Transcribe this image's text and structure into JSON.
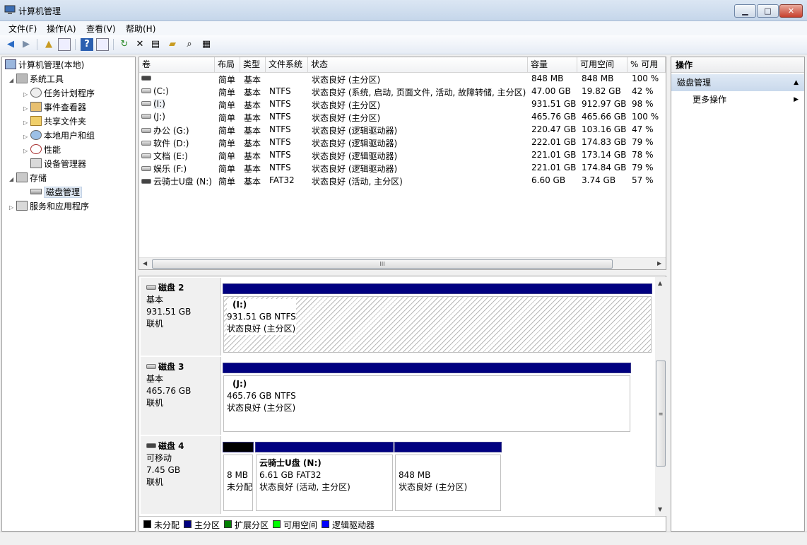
{
  "window": {
    "title": "计算机管理",
    "min": "▁",
    "max": "□",
    "close": "✕"
  },
  "menu": [
    "文件(F)",
    "操作(A)",
    "查看(V)",
    "帮助(H)"
  ],
  "tree": {
    "root": "计算机管理(本地)",
    "system_tools": "系统工具",
    "task_scheduler": "任务计划程序",
    "event_viewer": "事件查看器",
    "shared_folders": "共享文件夹",
    "local_users": "本地用户和组",
    "performance": "性能",
    "device_manager": "设备管理器",
    "storage": "存储",
    "disk_management": "磁盘管理",
    "services": "服务和应用程序"
  },
  "volumes": {
    "headers": [
      "卷",
      "布局",
      "类型",
      "文件系统",
      "状态",
      "容量",
      "可用空间",
      "% 可用"
    ],
    "rows": [
      [
        "",
        "简单",
        "基本",
        "",
        "状态良好 (主分区)",
        "848 MB",
        "848 MB",
        "100 %"
      ],
      [
        "(C:)",
        "简单",
        "基本",
        "NTFS",
        "状态良好 (系统, 启动, 页面文件, 活动, 故障转储, 主分区)",
        "47.00 GB",
        "19.82 GB",
        "42 %"
      ],
      [
        "(I:)",
        "简单",
        "基本",
        "NTFS",
        "状态良好 (主分区)",
        "931.51 GB",
        "912.97 GB",
        "98 %"
      ],
      [
        "(J:)",
        "简单",
        "基本",
        "NTFS",
        "状态良好 (主分区)",
        "465.76 GB",
        "465.66 GB",
        "100 %"
      ],
      [
        "办公 (G:)",
        "简单",
        "基本",
        "NTFS",
        "状态良好 (逻辑驱动器)",
        "220.47 GB",
        "103.16 GB",
        "47 %"
      ],
      [
        "软件 (D:)",
        "简单",
        "基本",
        "NTFS",
        "状态良好 (逻辑驱动器)",
        "222.01 GB",
        "174.83 GB",
        "79 %"
      ],
      [
        "文档 (E:)",
        "简单",
        "基本",
        "NTFS",
        "状态良好 (逻辑驱动器)",
        "221.01 GB",
        "173.14 GB",
        "78 %"
      ],
      [
        "娱乐 (F:)",
        "简单",
        "基本",
        "NTFS",
        "状态良好 (逻辑驱动器)",
        "221.01 GB",
        "174.84 GB",
        "79 %"
      ],
      [
        "云骑士U盘 (N:)",
        "简单",
        "基本",
        "FAT32",
        "状态良好 (活动, 主分区)",
        "6.60 GB",
        "3.74 GB",
        "57 %"
      ]
    ],
    "scroll_grip": "III"
  },
  "disks": {
    "disk2": {
      "name": "磁盘 2",
      "type": "基本",
      "size": "931.51 GB",
      "status": "联机",
      "part": {
        "label": "(I:)",
        "fs": "931.51 GB NTFS",
        "status": "状态良好 (主分区)"
      }
    },
    "disk3": {
      "name": "磁盘 3",
      "type": "基本",
      "size": "465.76 GB",
      "status": "联机",
      "part": {
        "label": "(J:)",
        "fs": "465.76 GB NTFS",
        "status": "状态良好 (主分区)"
      }
    },
    "disk4": {
      "name": "磁盘 4",
      "type": "可移动",
      "size": "7.45 GB",
      "status": "联机",
      "unalloc": {
        "size": "8 MB",
        "status": "未分配"
      },
      "part1": {
        "label": "云骑士U盘  (N:)",
        "fs": "6.61 GB FAT32",
        "status": "状态良好 (活动, 主分区)"
      },
      "part2": {
        "size": "848 MB",
        "status": "状态良好 (主分区)"
      }
    }
  },
  "legend": [
    {
      "label": "未分配",
      "color": "#000000"
    },
    {
      "label": "主分区",
      "color": "#000080"
    },
    {
      "label": "扩展分区",
      "color": "#008000"
    },
    {
      "label": "可用空间",
      "color": "#00ff00"
    },
    {
      "label": "逻辑驱动器",
      "color": "#0000ff"
    }
  ],
  "actions": {
    "title": "操作",
    "section": "磁盘管理",
    "more": "更多操作"
  }
}
